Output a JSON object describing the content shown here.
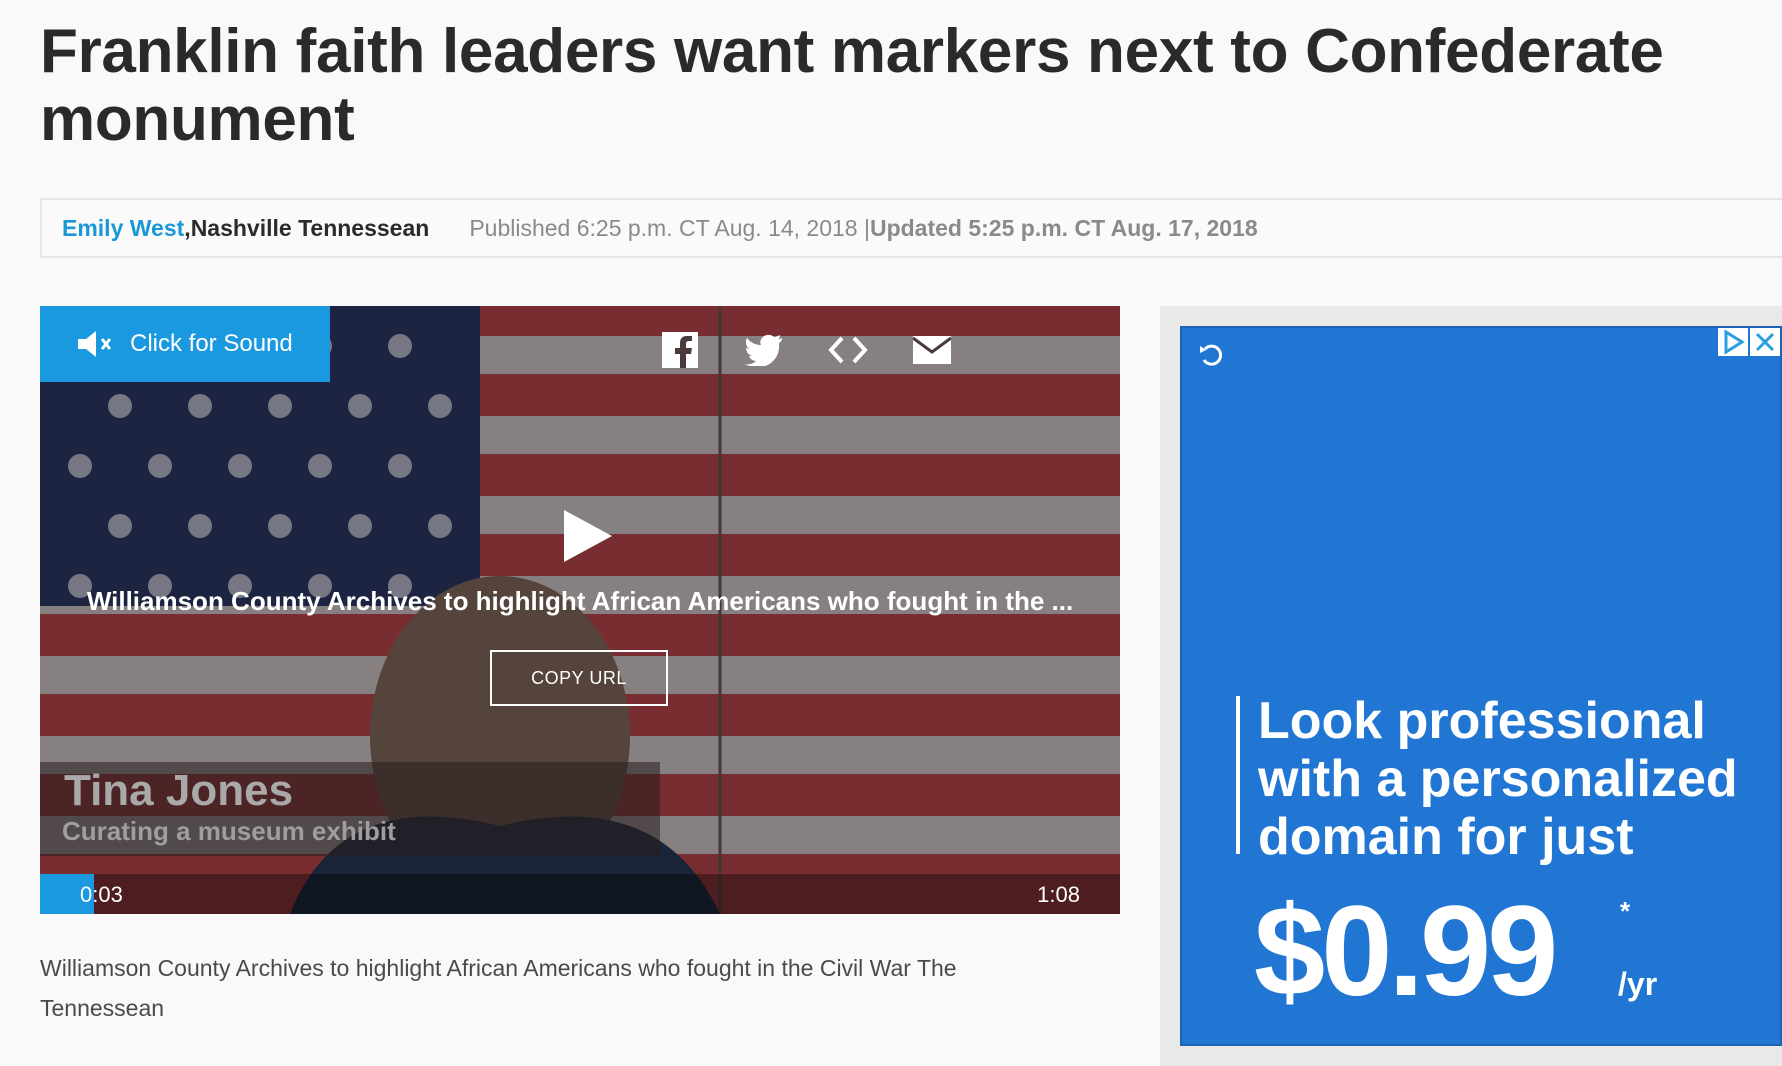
{
  "article": {
    "headline": "Franklin faith leaders want markers next to Confederate monument",
    "author": "Emily West",
    "separator": ", ",
    "publication": "Nashville Tennessean",
    "published": "Published 6:25 p.m. CT Aug. 14, 2018 | ",
    "updated": "Updated 5:25 p.m. CT Aug. 17, 2018"
  },
  "video": {
    "sound_label": "Click for Sound",
    "title": "Williamson County Archives to highlight African Americans who fought in the ...",
    "copy_url_label": "COPY URL",
    "lower_third_name": "Tina Jones",
    "lower_third_subtitle": "Curating a museum exhibit",
    "current_time": "0:03",
    "duration": "1:08",
    "progress_fraction": 0.05,
    "share_icons": [
      "facebook-icon",
      "twitter-icon",
      "embed-icon",
      "email-icon"
    ],
    "caption": "Williamson County Archives to highlight African Americans who fought in the Civil War The Tennessean"
  },
  "ad": {
    "line1": "Look professional",
    "line2": "with a personalized",
    "line3": "domain for just",
    "price": "$0.99",
    "asterisk": "*",
    "per": "/yr",
    "background": "#2176d4"
  },
  "colors": {
    "accent": "#1a98e0",
    "author_link": "#1a98d5"
  }
}
